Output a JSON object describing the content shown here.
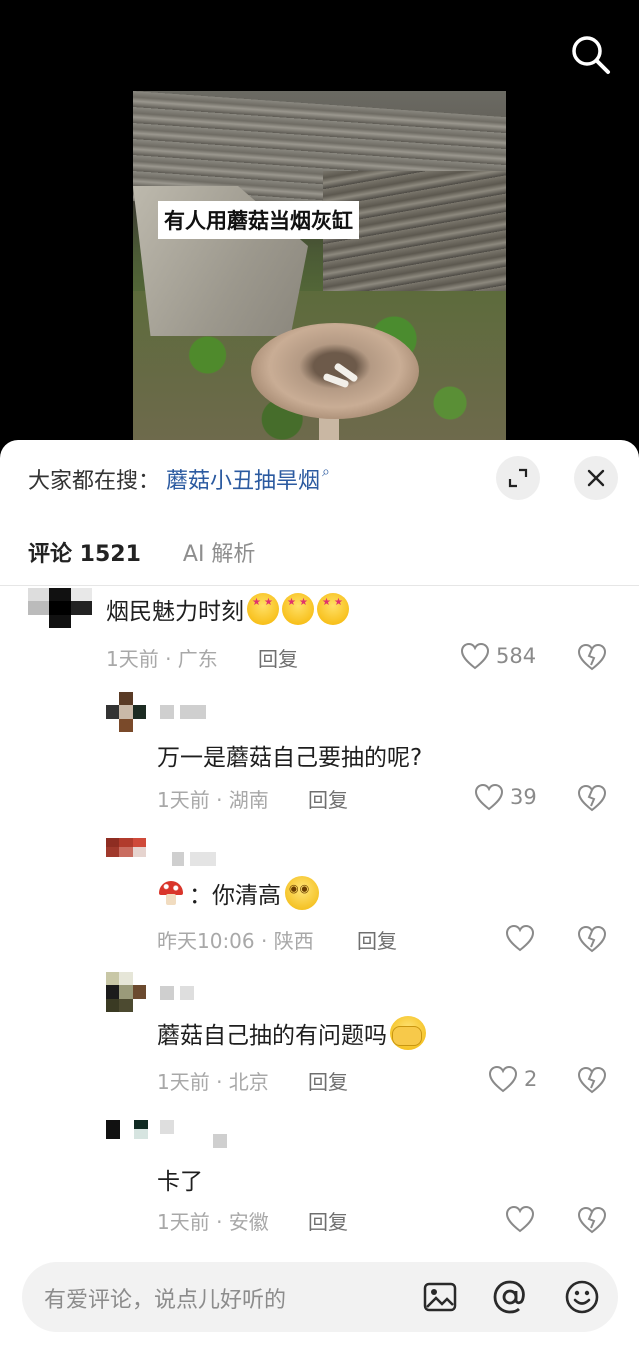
{
  "video": {
    "caption": "有人用蘑菇当烟灰缸"
  },
  "sheet": {
    "trend_prefix": "大家都在搜：",
    "trend_keyword": "蘑菇小丑抽旱烟",
    "trend_icon": "search-mini-icon"
  },
  "tabs": {
    "comments_label": "评论 1521",
    "ai_label": "AI 解析"
  },
  "comments": [
    {
      "text": "烟民魅力时刻",
      "time_location": "1天前 · 广东",
      "reply": "回复",
      "likes": "584"
    },
    {
      "text": "万一是蘑菇自己要抽的呢?",
      "time_location": "1天前 · 湖南",
      "reply": "回复",
      "likes": "39"
    },
    {
      "text": "：你清高",
      "time_location": "昨天10:06 · 陕西",
      "reply": "回复",
      "likes": ""
    },
    {
      "text": "蘑菇自己抽的有问题吗",
      "time_location": "1天前 · 北京",
      "reply": "回复",
      "likes": "2"
    },
    {
      "text": "卡了",
      "time_location": "1天前 · 安徽",
      "reply": "回复",
      "likes": ""
    }
  ],
  "input": {
    "placeholder": "有爱评论，说点儿好听的"
  },
  "colors": {
    "link": "#2b5aa0",
    "background_top": "#000000",
    "sheet": "#ffffff"
  }
}
